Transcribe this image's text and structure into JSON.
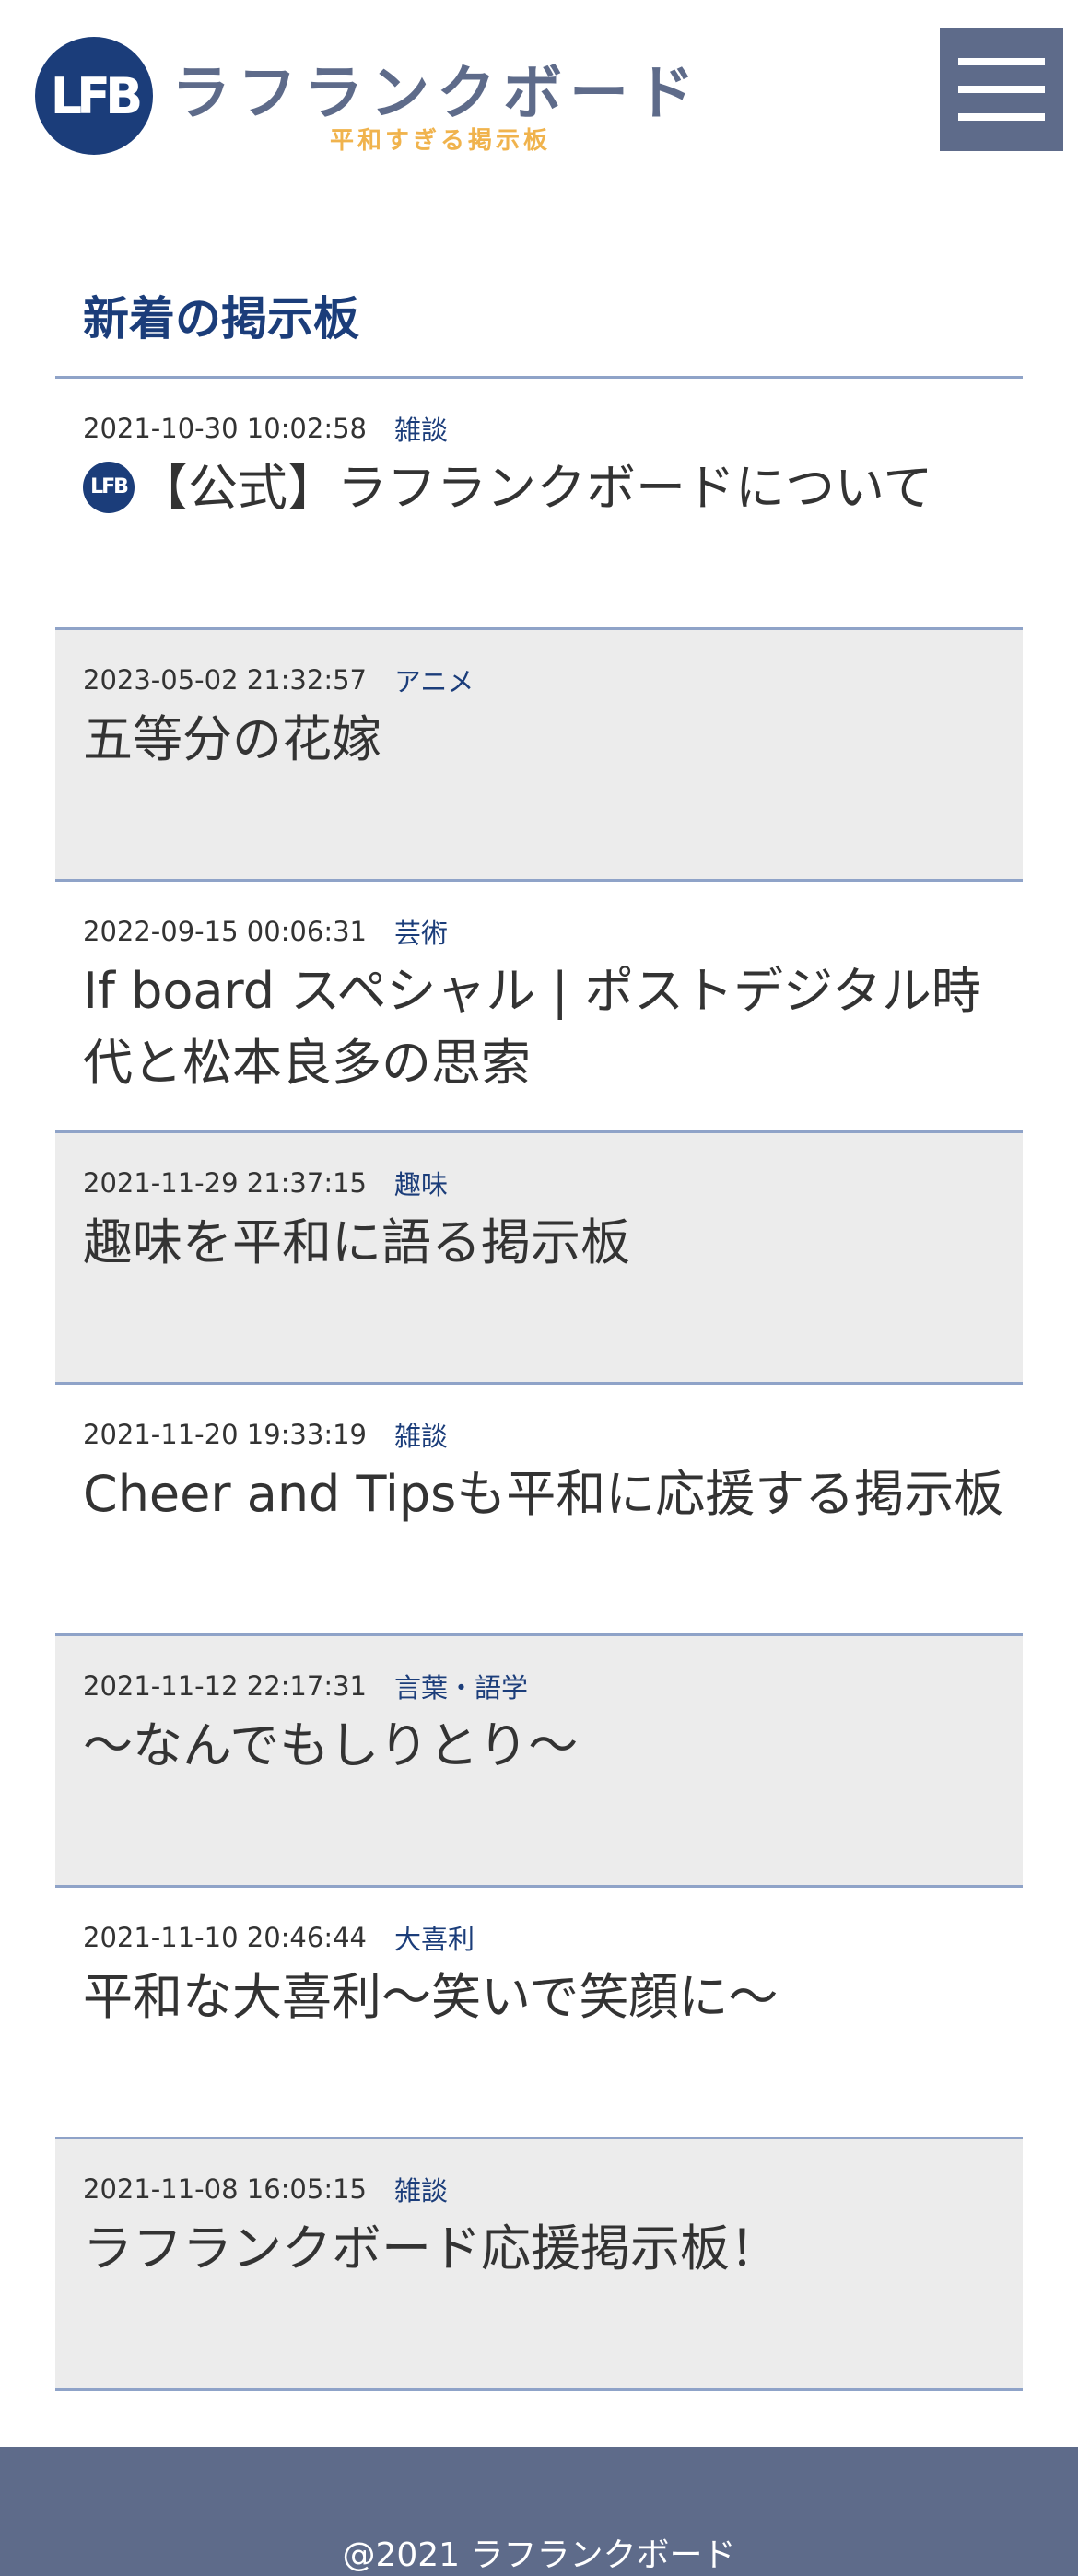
{
  "header": {
    "logo_mark": "LFB",
    "logo_title": "ラフランクボード",
    "logo_subtitle": "平和すぎる掲示板",
    "menu_icon": "hamburger-menu-icon",
    "colors": {
      "brand_navy": "#1b3d7a",
      "slate": "#5e6b8a",
      "accent_orange": "#f0b34d"
    }
  },
  "main": {
    "section_title": "新着の掲示板",
    "boards": [
      {
        "date": "2021-10-30 10:02:58",
        "category": "雑談",
        "title": "【公式】ラフランクボードについて",
        "official_icon": "LFB"
      },
      {
        "date": "2023-05-02 21:32:57",
        "category": "アニメ",
        "title": "五等分の花嫁"
      },
      {
        "date": "2022-09-15 00:06:31",
        "category": "芸術",
        "title": "If board スペシャル | ポストデジタル時代と松本良多の思索"
      },
      {
        "date": "2021-11-29 21:37:15",
        "category": "趣味",
        "title": "趣味を平和に語る掲示板"
      },
      {
        "date": "2021-11-20 19:33:19",
        "category": "雑談",
        "title": "Cheer and Tipsも平和に応援する掲示板"
      },
      {
        "date": "2021-11-12 22:17:31",
        "category": "言葉・語学",
        "title": "〜なんでもしりとり〜"
      },
      {
        "date": "2021-11-10 20:46:44",
        "category": "大喜利",
        "title": "平和な大喜利〜笑いで笑顔に〜"
      },
      {
        "date": "2021-11-08 16:05:15",
        "category": "雑談",
        "title": "ラフランクボード応援掲示板！"
      }
    ]
  },
  "footer": {
    "copyright": "@2021 ラフランクボード"
  }
}
